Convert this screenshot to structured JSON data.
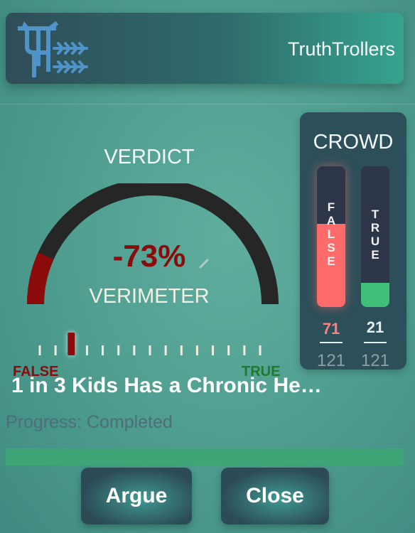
{
  "header": {
    "app_title": "TruthTrollers",
    "logo_icon": "trident-logo-icon"
  },
  "verdict": {
    "label": "VERDICT",
    "percent_text": "-73%",
    "percent_value": -73,
    "meter_label": "VERIMETER",
    "false_label": "FALSE",
    "true_label": "TRUE",
    "colors": {
      "false": "#8b0b0b",
      "true": "#1f7a2f",
      "track": "#262626"
    }
  },
  "crowd": {
    "title": "CROWD",
    "false": {
      "letters": [
        "F",
        "A",
        "L",
        "S",
        "E"
      ],
      "count": "71",
      "total": "121",
      "fill_fraction": 0.59,
      "color": "#ff6b6b"
    },
    "true": {
      "letters": [
        "T",
        "R",
        "U",
        "E"
      ],
      "count": "21",
      "total": "121",
      "fill_fraction": 0.17,
      "color": "#3fbf78"
    }
  },
  "article": {
    "headline": "1 in 3 Kids Has a Chronic He…"
  },
  "progress": {
    "label": "Progress: Completed",
    "fraction": 1.0
  },
  "buttons": {
    "argue": "Argue",
    "close": "Close"
  }
}
